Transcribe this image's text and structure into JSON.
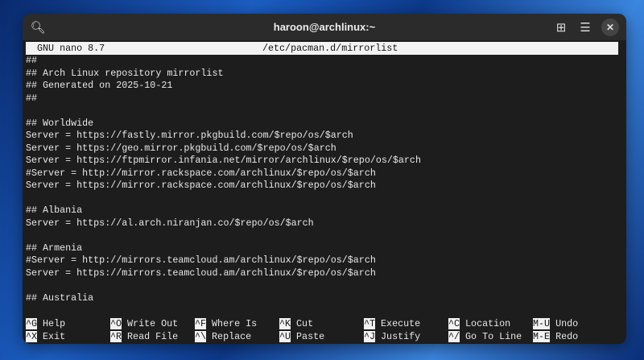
{
  "window": {
    "title": "haroon@archlinux:~"
  },
  "nano": {
    "version": "GNU nano 8.7",
    "filename": "/etc/pacman.d/mirrorlist"
  },
  "lines": [
    "##",
    "## Arch Linux repository mirrorlist",
    "## Generated on 2025-10-21",
    "##",
    "",
    "## Worldwide",
    "Server = https://fastly.mirror.pkgbuild.com/$repo/os/$arch",
    "Server = https://geo.mirror.pkgbuild.com/$repo/os/$arch",
    "Server = https://ftpmirror.infania.net/mirror/archlinux/$repo/os/$arch",
    "#Server = http://mirror.rackspace.com/archlinux/$repo/os/$arch",
    "Server = https://mirror.rackspace.com/archlinux/$repo/os/$arch",
    "",
    "## Albania",
    "Server = https://al.arch.niranjan.co/$repo/os/$arch",
    "",
    "## Armenia",
    "#Server = http://mirrors.teamcloud.am/archlinux/$repo/os/$arch",
    "Server = https://mirrors.teamcloud.am/archlinux/$repo/os/$arch",
    "",
    "## Australia"
  ],
  "shortcuts": [
    [
      {
        "key": "^G",
        "label": "Help"
      },
      {
        "key": "^O",
        "label": "Write Out"
      },
      {
        "key": "^F",
        "label": "Where Is"
      },
      {
        "key": "^K",
        "label": "Cut"
      },
      {
        "key": "^T",
        "label": "Execute"
      },
      {
        "key": "^C",
        "label": "Location"
      },
      {
        "key": "M-U",
        "label": "Undo"
      }
    ],
    [
      {
        "key": "^X",
        "label": "Exit"
      },
      {
        "key": "^R",
        "label": "Read File"
      },
      {
        "key": "^\\",
        "label": "Replace"
      },
      {
        "key": "^U",
        "label": "Paste"
      },
      {
        "key": "^J",
        "label": "Justify"
      },
      {
        "key": "^/",
        "label": "Go To Line"
      },
      {
        "key": "M-E",
        "label": "Redo"
      }
    ]
  ]
}
